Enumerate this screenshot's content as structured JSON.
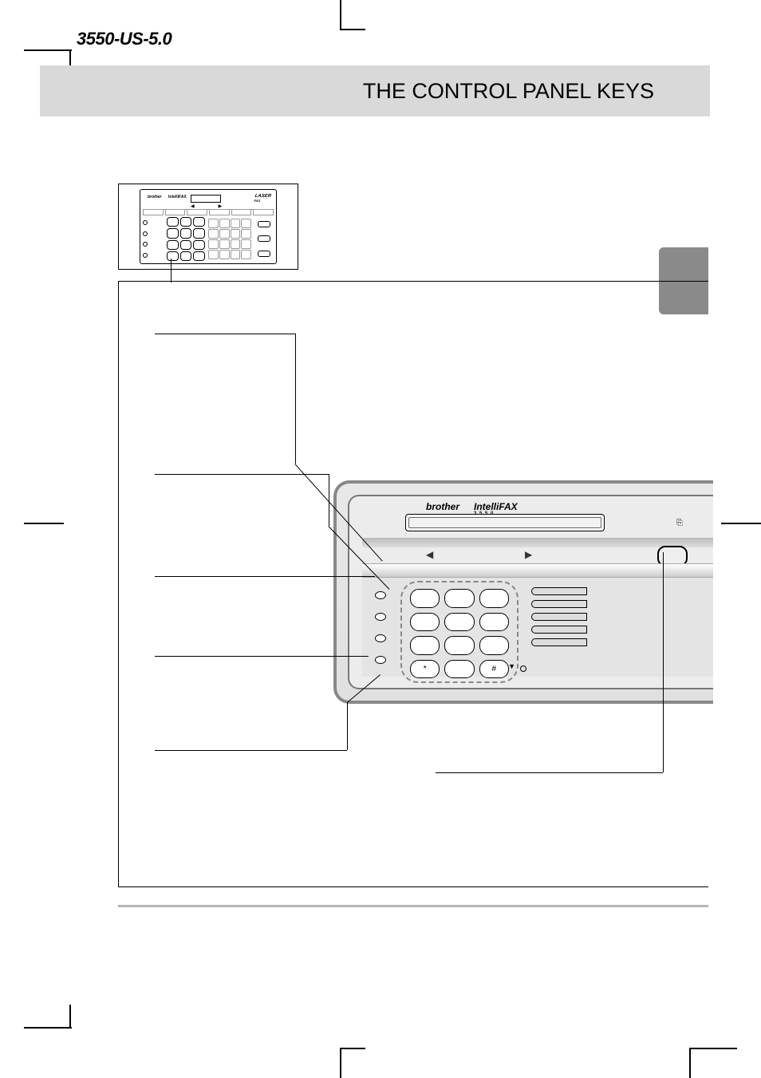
{
  "doc_id": "3550-US-5.0",
  "header_title": "THE CONTROL PANEL KEYS",
  "thumbnail": {
    "brand": "brother",
    "model": "IntelliFAX",
    "logo_label": "LASER",
    "logo_sub": "FAX"
  },
  "device": {
    "brand": "brother",
    "model": "IntelliFAX",
    "model_sub": "3 5 5 0",
    "keypad": {
      "star": "*",
      "hash": "#"
    },
    "arrow_left": "◀",
    "arrow_right": "▶",
    "speaker_arrow": "▼",
    "paper_icon": "⎘"
  }
}
